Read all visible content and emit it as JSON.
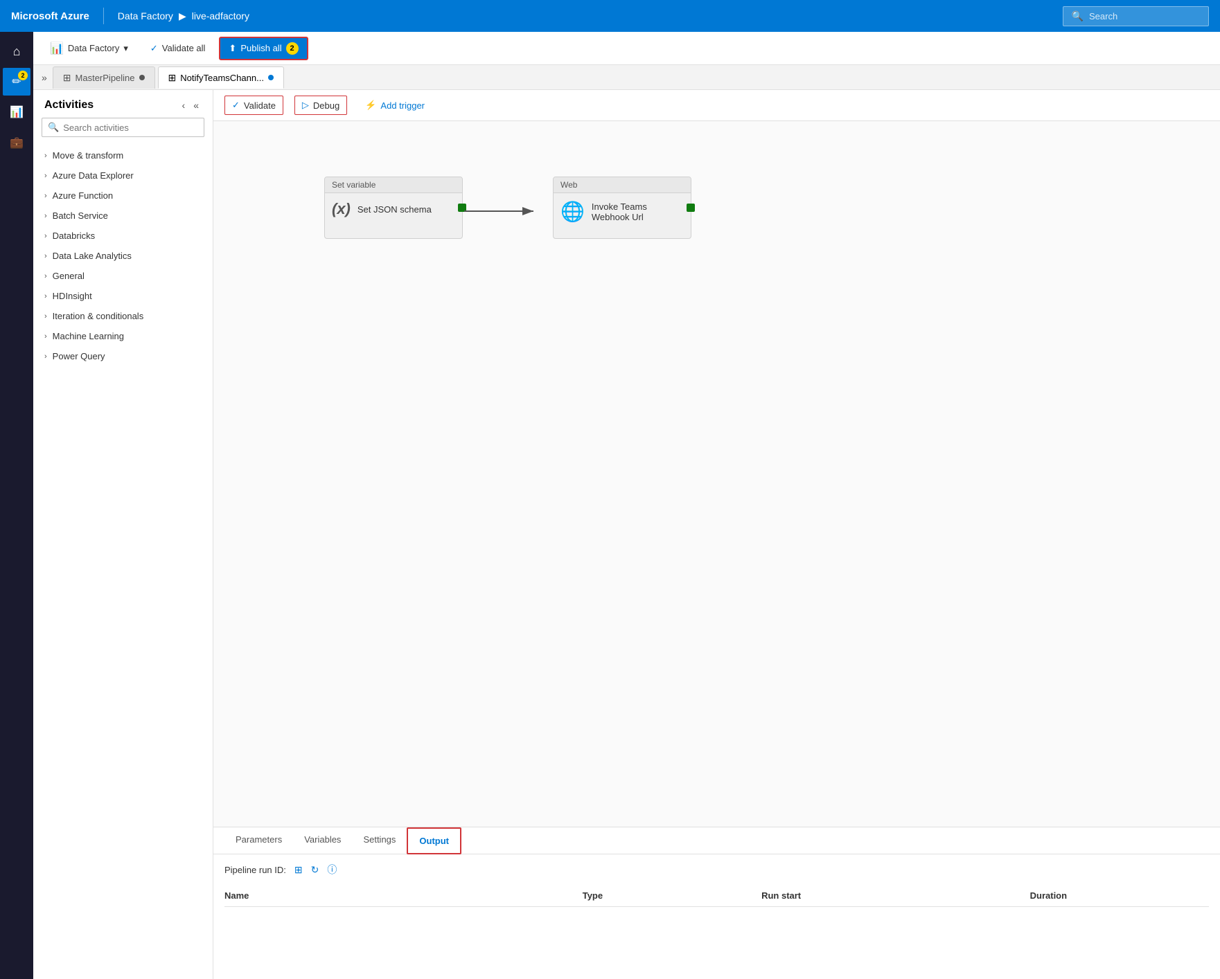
{
  "topbar": {
    "brand": "Microsoft Azure",
    "separator": "|",
    "breadcrumb": [
      "Data Factory",
      "live-adfactory"
    ],
    "search_placeholder": "Search"
  },
  "toolbar": {
    "data_factory_label": "Data Factory",
    "validate_all_label": "Validate all",
    "publish_all_label": "Publish all",
    "publish_badge": "2"
  },
  "tabs": [
    {
      "label": "MasterPipeline",
      "active": false
    },
    {
      "label": "NotifyTeamsChann...",
      "active": true
    }
  ],
  "canvas_toolbar": {
    "validate_label": "Validate",
    "debug_label": "Debug",
    "add_trigger_label": "Add trigger"
  },
  "activities": {
    "title": "Activities",
    "search_placeholder": "Search activities",
    "groups": [
      "Move & transform",
      "Azure Data Explorer",
      "Azure Function",
      "Batch Service",
      "Databricks",
      "Data Lake Analytics",
      "General",
      "HDInsight",
      "Iteration & conditionals",
      "Machine Learning",
      "Power Query"
    ]
  },
  "pipeline": {
    "node1": {
      "header": "Set variable",
      "icon": "(x)",
      "label": "Set JSON schema"
    },
    "node2": {
      "header": "Web",
      "label": "Invoke Teams\nWebhook Url"
    }
  },
  "bottom_panel": {
    "tabs": [
      "Parameters",
      "Variables",
      "Settings",
      "Output"
    ],
    "active_tab": "Output",
    "run_id_label": "Pipeline run ID:",
    "table_headers": [
      "Name",
      "Type",
      "Run start",
      "Duration"
    ]
  },
  "icons": {
    "home": "⌂",
    "pencil": "✏",
    "monitor": "🖥",
    "briefcase": "💼",
    "search": "🔍",
    "validate_check": "✓",
    "debug_play": "▷",
    "trigger": "⚡",
    "publish": "⬆",
    "chevron_right": "›",
    "chevron_down": "⌄",
    "collapse": "«",
    "expand": "»",
    "double_left": "‹‹",
    "refresh": "↻",
    "info": "ⓘ",
    "copy": "⊞",
    "globe": "🌐"
  }
}
